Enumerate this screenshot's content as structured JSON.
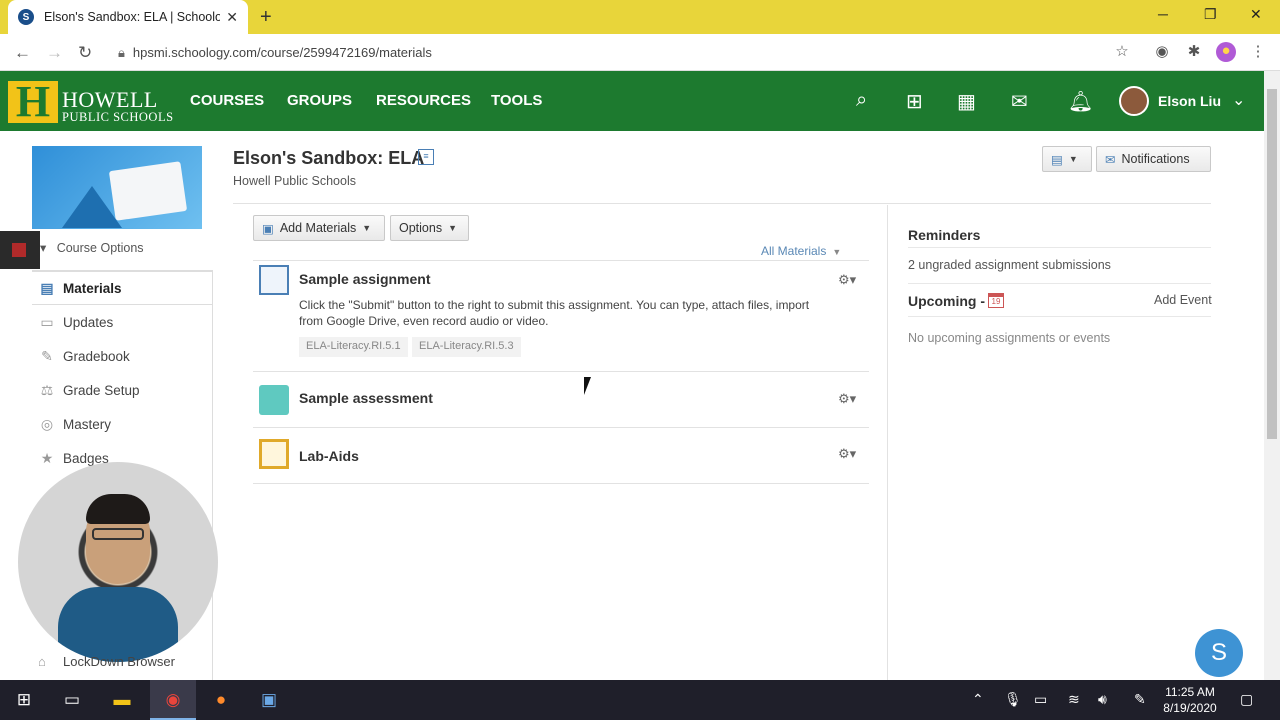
{
  "browser": {
    "tab_title": "Elson's Sandbox: ELA | Schoology",
    "favicon_letter": "S",
    "url": "hpsmi.schoology.com/course/2599472169/materials"
  },
  "header": {
    "logo_letter": "H",
    "logo_line1": "HOWELL",
    "logo_line2": "PUBLIC SCHOOLS",
    "nav": [
      "COURSES",
      "GROUPS",
      "RESOURCES",
      "TOOLS"
    ],
    "user_name": "Elson Liu"
  },
  "sidebar": {
    "course_options": "Course Options",
    "items": [
      {
        "label": "Materials"
      },
      {
        "label": "Updates"
      },
      {
        "label": "Gradebook"
      },
      {
        "label": "Grade Setup"
      },
      {
        "label": "Mastery"
      },
      {
        "label": "Badges"
      }
    ],
    "lockdown": "LockDown Browser"
  },
  "course": {
    "title": "Elson's Sandbox: ELA",
    "school": "Howell Public Schools",
    "notifications": "Notifications"
  },
  "toolbar": {
    "add_materials": "Add Materials",
    "options": "Options",
    "all_materials": "All Materials"
  },
  "materials": [
    {
      "title": "Sample assignment",
      "description": "Click the \"Submit\" button to the right to submit this assignment. You can type, attach files, import from Google Drive, even record audio or video.",
      "tags": [
        "ELA-Literacy.RI.5.1",
        "ELA-Literacy.RI.5.3"
      ]
    },
    {
      "title": "Sample assessment"
    },
    {
      "title": "Lab-Aids"
    }
  ],
  "right": {
    "reminders_title": "Reminders",
    "reminders_text": "2 ungraded assignment submissions",
    "upcoming_title": "Upcoming -",
    "cal_day": "19",
    "add_event": "Add Event",
    "upcoming_empty": "No upcoming assignments or events"
  },
  "chat_letter": "S",
  "taskbar": {
    "time": "11:25 AM",
    "date": "8/19/2020"
  }
}
